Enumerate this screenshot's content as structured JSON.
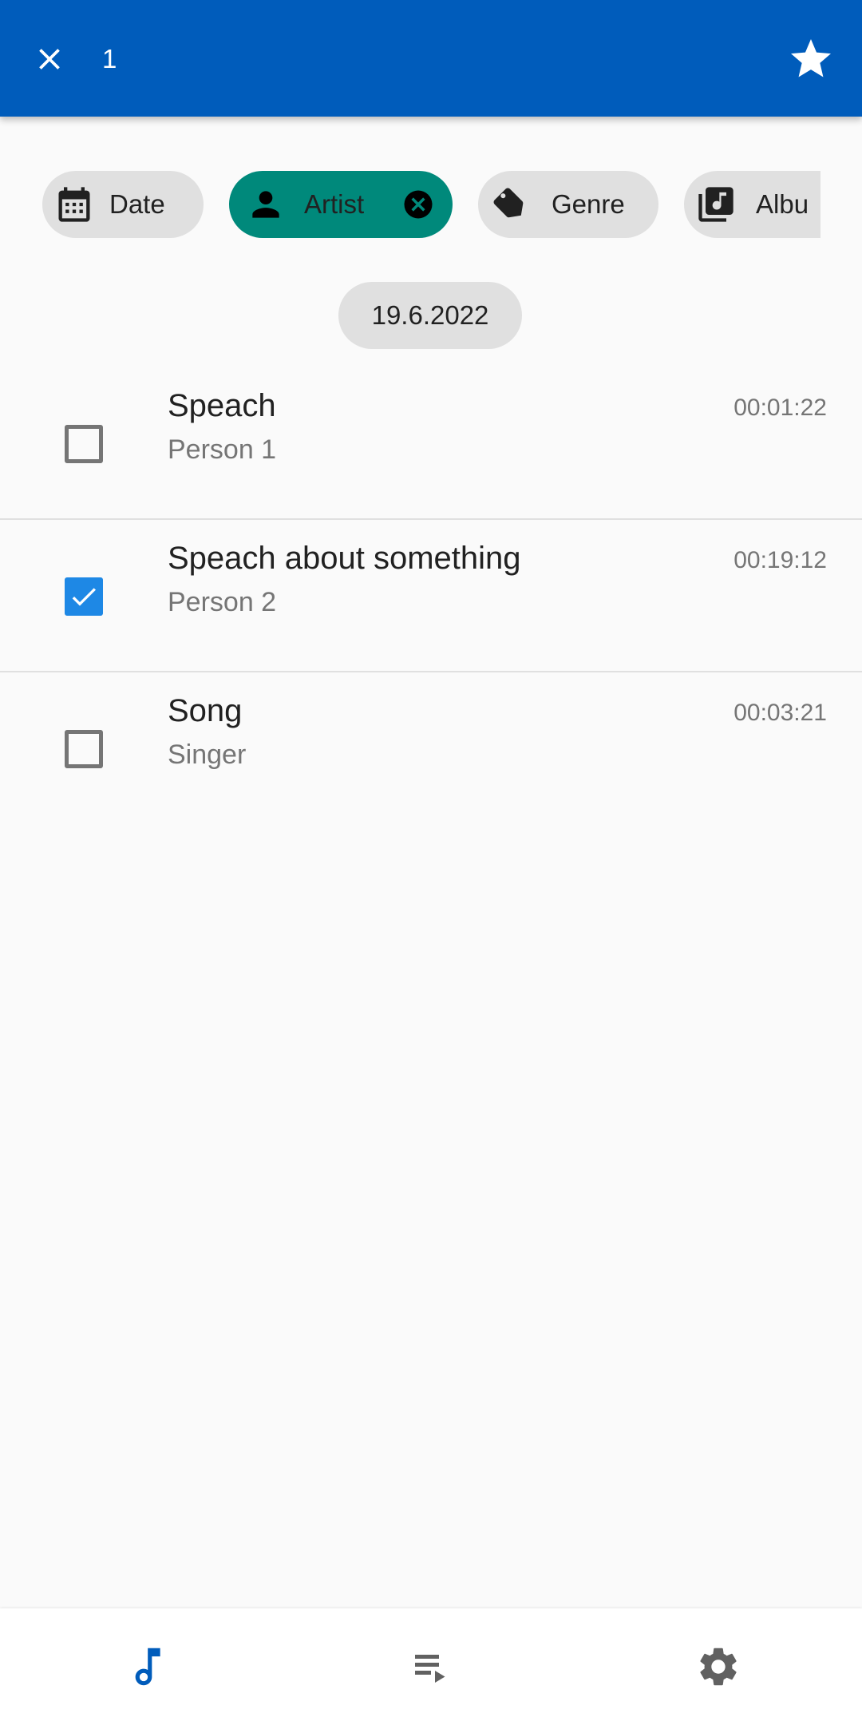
{
  "app_bar": {
    "background_color": "#005cbb",
    "close_icon": "close-icon",
    "selected_count": "1",
    "star_icon": "star-icon"
  },
  "filter_chips": [
    {
      "label": "Date",
      "icon": "calendar-icon",
      "selected": false
    },
    {
      "label": "Artist",
      "icon": "person-icon",
      "selected": true,
      "color": "#00897b"
    },
    {
      "label": "Genre",
      "icon": "tag-icon",
      "selected": false
    },
    {
      "label": "Albu",
      "icon": "album-icon",
      "selected": false
    }
  ],
  "date_header": "19.6.2022",
  "tracks": [
    {
      "title": "Speach",
      "artist": "Person 1",
      "duration": "00:01:22",
      "checked": false
    },
    {
      "title": "Speach about something",
      "artist": "Person 2",
      "duration": "00:19:12",
      "checked": true
    },
    {
      "title": "Song",
      "artist": "Singer",
      "duration": "00:03:21",
      "checked": false
    }
  ],
  "bottom_nav": {
    "items": [
      {
        "icon": "music-note-icon",
        "active": true,
        "color": "#005cbb"
      },
      {
        "icon": "queue-play-icon",
        "active": false
      },
      {
        "icon": "gear-icon",
        "active": false
      }
    ]
  },
  "colors": {
    "primary": "#005cbb",
    "accent_chip": "#00897b",
    "checkbox_checked": "#1e88e5"
  }
}
